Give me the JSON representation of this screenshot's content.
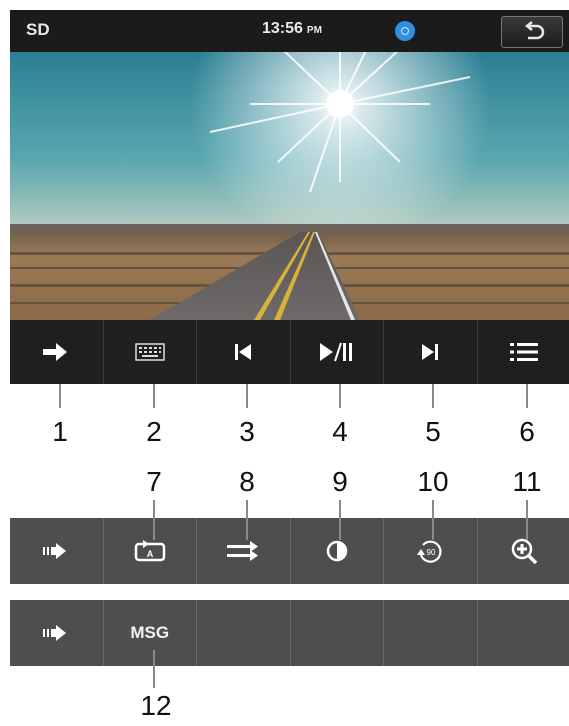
{
  "status_bar": {
    "source": "SD",
    "time": "13:56",
    "ampm": "PM",
    "disc_icon": "disc-icon",
    "back_icon": "back-arrow-icon"
  },
  "row1": [
    {
      "name": "more-arrow",
      "icon": "arrow-right-icon"
    },
    {
      "name": "keyboard",
      "icon": "keyboard-icon"
    },
    {
      "name": "previous-track",
      "icon": "skip-previous-icon"
    },
    {
      "name": "play-pause",
      "icon": "play-pause-icon"
    },
    {
      "name": "next-track",
      "icon": "skip-next-icon"
    },
    {
      "name": "list",
      "icon": "list-icon"
    }
  ],
  "row2": [
    {
      "name": "more-arrow",
      "icon": "arrow-right-icon"
    },
    {
      "name": "repeat",
      "icon": "repeat-a-icon"
    },
    {
      "name": "shuffle",
      "icon": "shuffle-icon"
    },
    {
      "name": "picture-adjust",
      "icon": "contrast-icon"
    },
    {
      "name": "rotate",
      "icon": "rotate-90-icon",
      "text": "90"
    },
    {
      "name": "zoom",
      "icon": "zoom-in-icon"
    }
  ],
  "row3": [
    {
      "name": "more-arrow",
      "icon": "arrow-right-icon"
    },
    {
      "name": "msg",
      "text": "MSG"
    }
  ],
  "callouts": [
    "1",
    "2",
    "3",
    "4",
    "5",
    "6",
    "7",
    "8",
    "9",
    "10",
    "11",
    "12"
  ],
  "colors": {
    "bar": "#1b1b1b",
    "row_light": "#4e4e4e",
    "disc": "#2f8fe0"
  }
}
